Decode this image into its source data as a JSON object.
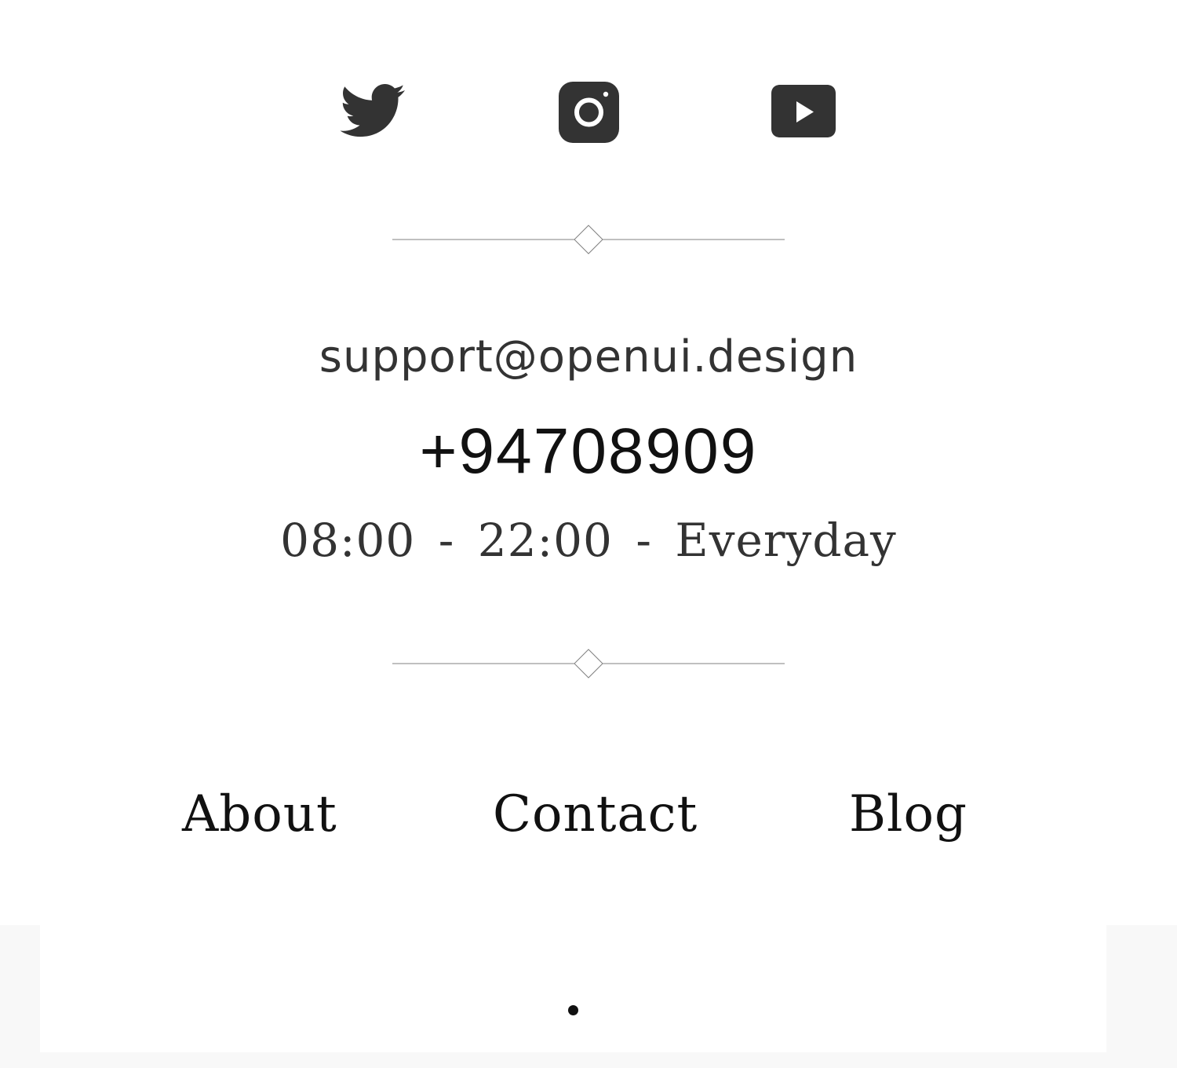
{
  "social": {
    "twitter": {
      "icon": "twitter-icon"
    },
    "instagram": {
      "icon": "instagram-icon"
    },
    "youtube": {
      "icon": "youtube-icon"
    },
    "icon_color": "#333333"
  },
  "contact": {
    "email": "support@openui.design",
    "phone": "+94708909",
    "hours": "08:00 - 22:00 - Everyday"
  },
  "nav": {
    "about": "About",
    "contact": "Contact",
    "blog": "Blog"
  },
  "pagination": {
    "active_index": 0
  },
  "colors": {
    "text_primary": "#111111",
    "text_secondary": "#333333",
    "divider": "#808080",
    "background_band": "#f8f8f8"
  }
}
